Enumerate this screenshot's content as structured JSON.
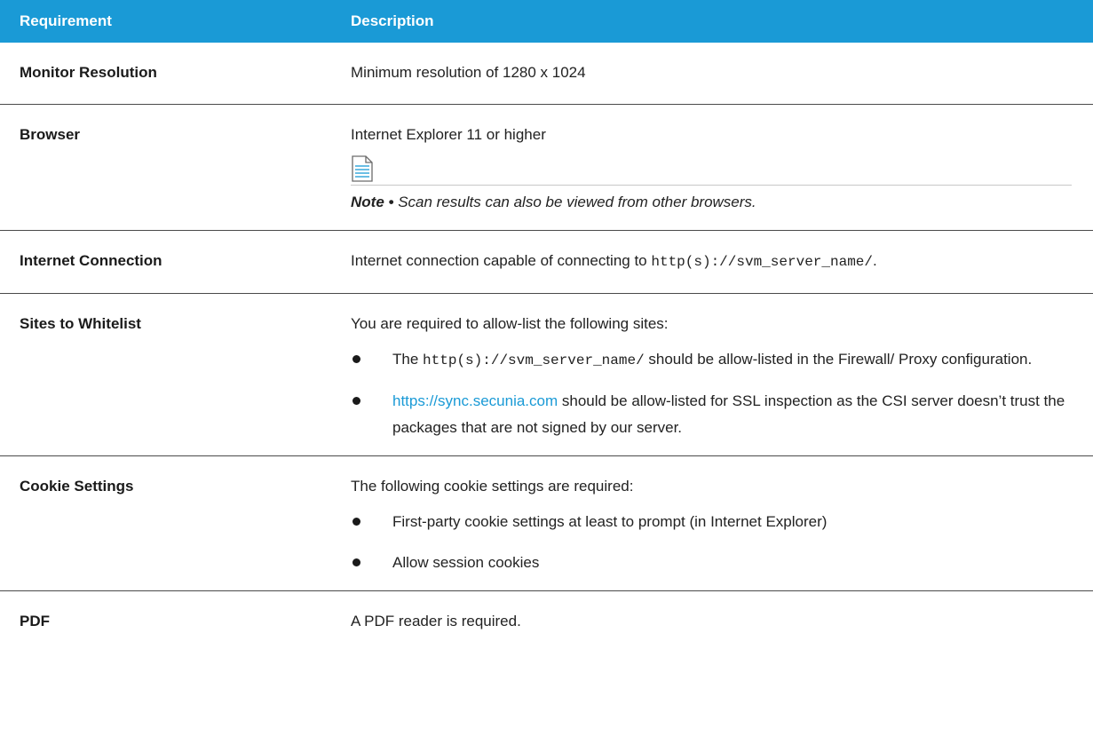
{
  "headers": {
    "requirement": "Requirement",
    "description": "Description"
  },
  "rows": {
    "monitor": {
      "name": "Monitor Resolution",
      "desc": "Minimum resolution of 1280 x 1024"
    },
    "browser": {
      "name": "Browser",
      "desc": "Internet Explorer 11 or higher",
      "note_icon": "document-icon",
      "note_label": "Note •",
      "note_text": "Scan results can also be viewed from other browsers."
    },
    "internet": {
      "name": "Internet Connection",
      "desc_before": "Internet connection capable of connecting to ",
      "desc_code": "http(s)://svm_server_name/",
      "desc_after": "."
    },
    "sites": {
      "name": "Sites to Whitelist",
      "intro": "You are required to allow-list the following sites:",
      "bullet1_code": "http(s)://svm_server_name/",
      "bullet1_before": "The ",
      "bullet1_after": " should be allow-listed in the Firewall/ Proxy configuration.",
      "bullet2_link": "https://sync.secunia.com",
      "bullet2_after": " should be allow-listed for SSL inspection as the CSI server doesn’t trust the packages that are not signed by our server."
    },
    "cookie": {
      "name": "Cookie Settings",
      "intro": "The following cookie settings are required:",
      "bullet1": "First-party cookie settings at least to prompt (in Internet Explorer)",
      "bullet2": "Allow session cookies"
    },
    "pdf": {
      "name": "PDF",
      "desc": "A PDF reader is required."
    }
  },
  "colors": {
    "header_bg": "#1a9ad6",
    "link": "#1a9ad6"
  }
}
